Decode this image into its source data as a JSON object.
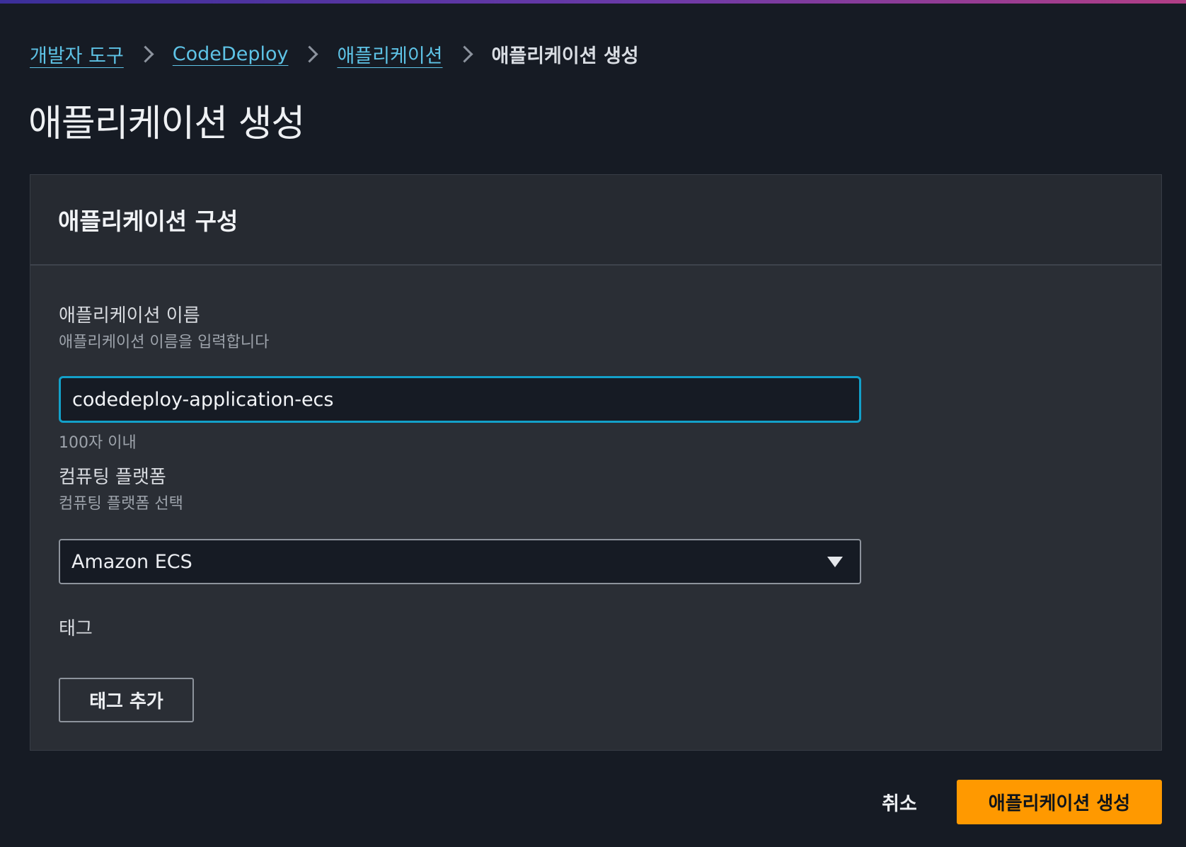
{
  "breadcrumb": {
    "items": [
      {
        "label": "개발자 도구"
      },
      {
        "label": "CodeDeploy"
      },
      {
        "label": "애플리케이션"
      }
    ],
    "current": "애플리케이션 생성"
  },
  "page": {
    "title": "애플리케이션 생성"
  },
  "panel": {
    "title": "애플리케이션 구성",
    "app_name": {
      "label": "애플리케이션 이름",
      "description": "애플리케이션 이름을 입력합니다",
      "value": "codedeploy-application-ecs",
      "constraint": "100자 이내"
    },
    "platform": {
      "label": "컴퓨팅 플랫폼",
      "description": "컴퓨팅 플랫폼 선택",
      "selected": "Amazon ECS"
    },
    "tags": {
      "label": "태그",
      "add_button": "태그 추가"
    }
  },
  "actions": {
    "cancel": "취소",
    "create": "애플리케이션 생성"
  },
  "colors": {
    "background": "#161b24",
    "panel": "#2a2e35",
    "link": "#5ec3e6",
    "focus_border": "#13a0c9",
    "primary_button": "#ff9900"
  },
  "icons": {
    "breadcrumb_separator": "chevron-right-icon",
    "select_caret": "caret-down-icon"
  }
}
